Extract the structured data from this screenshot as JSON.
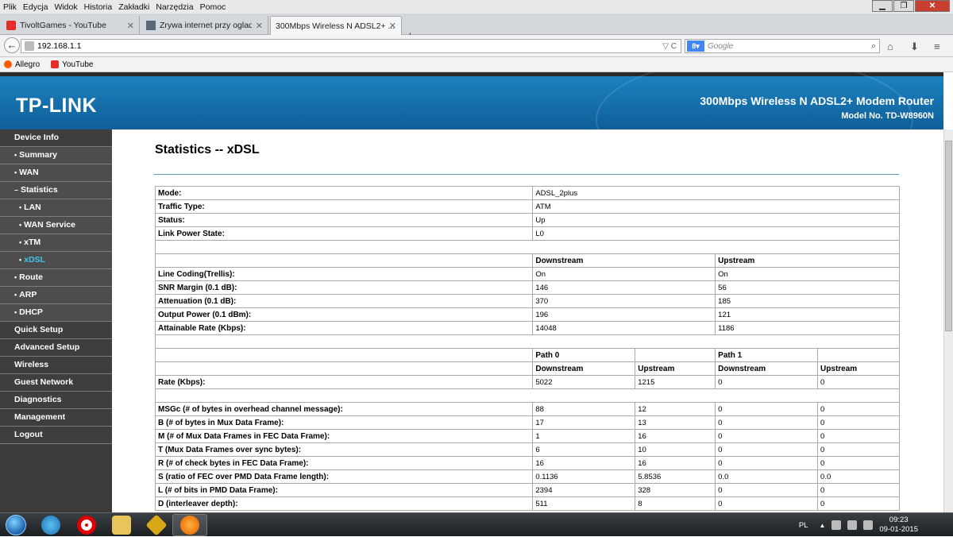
{
  "browser": {
    "menu": [
      "Plik",
      "Edycja",
      "Widok",
      "Historia",
      "Zakładki",
      "Narzędzia",
      "Pomoc"
    ],
    "tabs": [
      {
        "label": "TivoltGames - YouTube",
        "active": false
      },
      {
        "label": "Zrywa internet przy ogladaniu...",
        "active": false
      },
      {
        "label": "300Mbps Wireless N ADSL2+ ...",
        "active": true
      }
    ],
    "url": "192.168.1.1",
    "search_placeholder": "Google",
    "bookmarks": [
      {
        "label": "Allegro",
        "color": "#ff5a00"
      },
      {
        "label": "YouTube",
        "color": "#e52d27"
      }
    ]
  },
  "router": {
    "logo": "TP-LINK",
    "product": "300Mbps Wireless N ADSL2+ Modem Router",
    "model": "Model No. TD-W8960N"
  },
  "sidebar": [
    {
      "label": "Device Info",
      "level": 1
    },
    {
      "label": "Summary",
      "level": 2
    },
    {
      "label": "WAN",
      "level": 2
    },
    {
      "label": "Statistics",
      "level": 2,
      "expanded": true
    },
    {
      "label": "LAN",
      "level": 3
    },
    {
      "label": "WAN Service",
      "level": 3
    },
    {
      "label": "xTM",
      "level": 3
    },
    {
      "label": "xDSL",
      "level": 3,
      "active": true
    },
    {
      "label": "Route",
      "level": 2
    },
    {
      "label": "ARP",
      "level": 2
    },
    {
      "label": "DHCP",
      "level": 2
    },
    {
      "label": "Quick Setup",
      "level": 1
    },
    {
      "label": "Advanced Setup",
      "level": 1
    },
    {
      "label": "Wireless",
      "level": 1
    },
    {
      "label": "Guest Network",
      "level": 1
    },
    {
      "label": "Diagnostics",
      "level": 1
    },
    {
      "label": "Management",
      "level": 1
    },
    {
      "label": "Logout",
      "level": 1
    }
  ],
  "page": {
    "title": "Statistics -- xDSL",
    "basic": [
      {
        "label": "Mode:",
        "value": "ADSL_2plus"
      },
      {
        "label": "Traffic Type:",
        "value": "ATM"
      },
      {
        "label": "Status:",
        "value": "Up"
      },
      {
        "label": "Link Power State:",
        "value": "L0"
      }
    ],
    "headers": {
      "downstream": "Downstream",
      "upstream": "Upstream",
      "path0": "Path 0",
      "path1": "Path 1"
    },
    "line": [
      {
        "label": "Line Coding(Trellis):",
        "down": "On",
        "up": "On"
      },
      {
        "label": "SNR Margin (0.1 dB):",
        "down": "146",
        "up": "56"
      },
      {
        "label": "Attenuation (0.1 dB):",
        "down": "370",
        "up": "185"
      },
      {
        "label": "Output Power (0.1 dBm):",
        "down": "196",
        "up": "121"
      },
      {
        "label": "Attainable Rate (Kbps):",
        "down": "14048",
        "up": "1186"
      }
    ],
    "rate": {
      "label": "Rate (Kbps):",
      "values": [
        "5022",
        "1215",
        "0",
        "0"
      ]
    },
    "framing": [
      {
        "label": "MSGc (# of bytes in overhead channel message):",
        "values": [
          "88",
          "12",
          "0",
          "0"
        ]
      },
      {
        "label": "B (# of bytes in Mux Data Frame):",
        "values": [
          "17",
          "13",
          "0",
          "0"
        ]
      },
      {
        "label": "M (# of Mux Data Frames in FEC Data Frame):",
        "values": [
          "1",
          "16",
          "0",
          "0"
        ]
      },
      {
        "label": "T (Mux Data Frames over sync bytes):",
        "values": [
          "6",
          "10",
          "0",
          "0"
        ]
      },
      {
        "label": "R (# of check bytes in FEC Data Frame):",
        "values": [
          "16",
          "16",
          "0",
          "0"
        ]
      },
      {
        "label": "S (ratio of FEC over PMD Data Frame length):",
        "values": [
          "0.1136",
          "5.8536",
          "0.0",
          "0.0"
        ]
      },
      {
        "label": "L (# of bits in PMD Data Frame):",
        "values": [
          "2394",
          "328",
          "0",
          "0"
        ]
      },
      {
        "label": "D (interleaver depth):",
        "values": [
          "511",
          "8",
          "0",
          "0"
        ]
      }
    ]
  },
  "taskbar": {
    "lang": "PL",
    "time": "09:23",
    "date": "09-01-2015"
  }
}
